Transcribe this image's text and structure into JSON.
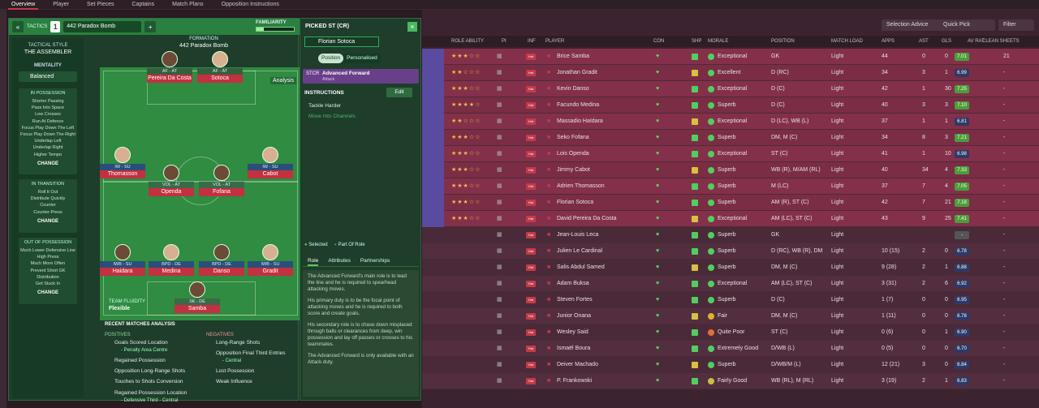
{
  "nav": {
    "tabs": [
      "Overview",
      "Player",
      "Set Pieces",
      "Captains",
      "Match Plans",
      "Opposition Instructions"
    ]
  },
  "tactics": {
    "label": "TACTICS",
    "number": "1",
    "formation_name": "442 Paradox Bomb",
    "familiarity": "FAMILIARITY",
    "tactical_style_label": "TACTICAL STYLE",
    "tactical_style": "THE ASSEMBLER",
    "mentality_label": "MENTALITY",
    "mentality": "Balanced",
    "in_possession": {
      "title": "IN POSSESSION",
      "items": [
        "Shorter Passing",
        "Pass Into Space",
        "Low Crosses",
        "Run At Defence",
        "Focus Play Down The Left",
        "Focus Play Down The Right",
        "Underlap Left",
        "Underlap Right",
        "Higher Tempo"
      ]
    },
    "in_transition": {
      "title": "IN TRANSITION",
      "items": [
        "Roll It Out",
        "Distribute Quickly",
        "Counter",
        "Counter-Press"
      ]
    },
    "out_of_possession": {
      "title": "OUT OF POSSESSION",
      "items": [
        "Much Lower Defensive Line",
        "High Press",
        "Much More Often",
        "Prevent Short GK Distribution",
        "Get Stuck In"
      ]
    },
    "change_label": "CHANGE",
    "formation_label": "FORMATION",
    "analysis": "Analysis",
    "team_fluidity_label": "TEAM FLUIDITY",
    "team_fluidity": "Flexible",
    "recent_label": "RECENT MATCHES ANALYSIS",
    "positives_label": "POSITIVES",
    "negatives_label": "NEGATIVES",
    "positives": [
      "Goals Scored Location",
      "- Penalty Area Centre",
      "Regained Possession",
      "Opposition Long-Range Shots",
      "Touches to Shots Conversion",
      "Regained Possession Location",
      "- Defensive Third - Central"
    ],
    "negatives": [
      "Long-Range Shots",
      "Opposition Final Third Entries",
      "- Central",
      "Lost Possession",
      "Weak Influence"
    ],
    "players": [
      {
        "role": "AF - AT",
        "name": "Pereira Da Costa"
      },
      {
        "role": "AF - AT",
        "name": "Sotoca"
      },
      {
        "role": "IW - SU",
        "name": "Thomasson"
      },
      {
        "role": "IW - SU",
        "name": "Cabot"
      },
      {
        "role": "VOL - AT",
        "name": "Openda"
      },
      {
        "role": "VOL - AT",
        "name": "Fofana"
      },
      {
        "role": "IWB - SU",
        "name": "Haidara"
      },
      {
        "role": "BPD - DE",
        "name": "Medina"
      },
      {
        "role": "BPD - DE",
        "name": "Danso"
      },
      {
        "role": "IWB - SU",
        "name": "Gradit"
      },
      {
        "role": "SK - DE",
        "name": "Samba"
      }
    ]
  },
  "picked": {
    "title": "PICKED ST (CR)",
    "player": "Florian Sotoca",
    "toggle": [
      "Position",
      "Personalised"
    ],
    "role_pos": "STCR",
    "role_name": "Advanced Forward",
    "role_duty": "Attack",
    "instructions_label": "INSTRUCTIONS",
    "edit": "Edit",
    "instr": [
      "Tackle Harder",
      "Move Into Channels"
    ],
    "legend_selected": "Selected",
    "legend_part": "Part Of Role",
    "tabs": [
      "Role",
      "Attributes",
      "Partnerships"
    ],
    "desc": [
      "The Advanced Forward's main role is to lead the line and he is required to spearhead attacking moves.",
      "His primary duty is to be the focal point of attacking moves and he is required to both score and create goals.",
      "His secondary role is to chase down misplaced through balls or clearances from deep, win possession and lay off passes or crosses to his teammates.",
      "The Advanced Forward is only available with an Attack duty."
    ]
  },
  "list": {
    "buttons": {
      "selection_advice": "Selection Advice",
      "quick_pick": "Quick Pick",
      "filter": "Filter"
    },
    "columns": [
      "ROLE ABILITY",
      "PI",
      "INF",
      "PLAYER",
      "CON",
      "SHP",
      "MORALE",
      "POSITION",
      "MATCH LOAD",
      "APPS",
      "AST",
      "GLS",
      "AV RAT",
      "CLEAN SHEETS"
    ],
    "rows": [
      {
        "stars": "★★★☆☆",
        "name": "Brice Samba",
        "morale": "Exceptional",
        "pos": "GK",
        "load": "Light",
        "apps": "44",
        "ast": "0",
        "gls": "0",
        "rat": "7.01",
        "cs": "21"
      },
      {
        "stars": "★★☆☆☆",
        "name": "Jonathan Gradit",
        "morale": "Excellent",
        "pos": "D (RC)",
        "load": "Light",
        "apps": "34",
        "ast": "3",
        "gls": "1",
        "rat": "6.99",
        "cs": "-"
      },
      {
        "stars": "★★★☆☆",
        "name": "Kevin Danso",
        "morale": "Exceptional",
        "pos": "D (C)",
        "load": "Light",
        "apps": "42",
        "ast": "1",
        "gls": "30",
        "rat": "7.25",
        "cs": "-"
      },
      {
        "stars": "★★★★☆",
        "name": "Facundo Medina",
        "morale": "Superb",
        "pos": "D (C)",
        "load": "Light",
        "apps": "40",
        "ast": "3",
        "gls": "3",
        "rat": "7.10",
        "cs": "-"
      },
      {
        "stars": "★★☆☆☆",
        "name": "Massadio Haïdara",
        "morale": "Exceptional",
        "pos": "D (LC), WB (L)",
        "load": "Light",
        "apps": "37",
        "ast": "1",
        "gls": "1",
        "rat": "6.81",
        "cs": "-"
      },
      {
        "stars": "★★★☆☆",
        "name": "Seko Fofana",
        "morale": "Superb",
        "pos": "DM, M (C)",
        "load": "Light",
        "apps": "34",
        "ast": "8",
        "gls": "3",
        "rat": "7.21",
        "cs": "-"
      },
      {
        "stars": "★★★☆☆",
        "name": "Lois Openda",
        "morale": "Exceptional",
        "pos": "ST (C)",
        "load": "Light",
        "apps": "41",
        "ast": "1",
        "gls": "10",
        "rat": "6.98",
        "cs": "-"
      },
      {
        "stars": "★★★☆☆",
        "name": "Jimmy Cabot",
        "morale": "Superb",
        "pos": "WB (R), M/AM (RL)",
        "load": "Light",
        "apps": "40",
        "ast": "34",
        "gls": "4",
        "rat": "7.33",
        "cs": "-"
      },
      {
        "stars": "★★★☆☆",
        "name": "Adrien Thomasson",
        "morale": "Superb",
        "pos": "M (LC)",
        "load": "Light",
        "apps": "37",
        "ast": "7",
        "gls": "4",
        "rat": "7.05",
        "cs": "-"
      },
      {
        "stars": "★★★☆☆",
        "name": "Florian Sotoca",
        "morale": "Superb",
        "pos": "AM (R), ST (C)",
        "load": "Light",
        "apps": "42",
        "ast": "7",
        "gls": "21",
        "rat": "7.18",
        "cs": "-"
      },
      {
        "stars": "★★★☆☆",
        "name": "David Pereira Da Costa",
        "morale": "Exceptional",
        "pos": "AM (LC), ST (C)",
        "load": "Light",
        "apps": "43",
        "ast": "9",
        "gls": "25",
        "rat": "7.41",
        "cs": "-"
      },
      {
        "stars": "",
        "name": "Jean-Louis Leca",
        "morale": "Superb",
        "pos": "GK",
        "load": "Light",
        "apps": "",
        "ast": "",
        "gls": "",
        "rat": "-",
        "cs": "-"
      },
      {
        "stars": "",
        "name": "Julien Le Cardinal",
        "morale": "Superb",
        "pos": "D (RC), WB (R), DM",
        "load": "Light",
        "apps": "10 (15)",
        "ast": "2",
        "gls": "0",
        "rat": "6.78",
        "cs": "-"
      },
      {
        "stars": "",
        "name": "Salis Abdul Samed",
        "morale": "Superb",
        "pos": "DM, M (C)",
        "load": "Light",
        "apps": "9 (28)",
        "ast": "2",
        "gls": "1",
        "rat": "6.88",
        "cs": "-"
      },
      {
        "stars": "",
        "name": "Adam Buksa",
        "morale": "Exceptional",
        "pos": "AM (LC), ST (C)",
        "load": "Light",
        "apps": "3 (31)",
        "ast": "2",
        "gls": "6",
        "rat": "6.92",
        "cs": "-"
      },
      {
        "stars": "",
        "name": "Steven Fortes",
        "morale": "Superb",
        "pos": "D (C)",
        "load": "Light",
        "apps": "1 (7)",
        "ast": "0",
        "gls": "0",
        "rat": "6.95",
        "cs": "-"
      },
      {
        "stars": "",
        "name": "Junior Onana",
        "morale": "Fair",
        "pos": "DM, M (C)",
        "load": "Light",
        "apps": "1 (11)",
        "ast": "0",
        "gls": "0",
        "rat": "6.78",
        "cs": "-"
      },
      {
        "stars": "",
        "name": "Wesley Said",
        "morale": "Quite Poor",
        "pos": "ST (C)",
        "load": "Light",
        "apps": "0 (6)",
        "ast": "0",
        "gls": "1",
        "rat": "6.90",
        "cs": "-"
      },
      {
        "stars": "",
        "name": "Ismaël Boura",
        "morale": "Extremely Good",
        "pos": "D/WB (L)",
        "load": "Light",
        "apps": "0 (5)",
        "ast": "0",
        "gls": "0",
        "rat": "6.70",
        "cs": "-"
      },
      {
        "stars": "",
        "name": "Deiver Machado",
        "morale": "Superb",
        "pos": "D/WB/M (L)",
        "load": "Light",
        "apps": "12 (21)",
        "ast": "3",
        "gls": "0",
        "rat": "6.84",
        "cs": "-"
      },
      {
        "stars": "",
        "name": "P. Frankowski",
        "morale": "Fairly Good",
        "pos": "WB (RL), M (RL)",
        "load": "Light",
        "apps": "3 (19)",
        "ast": "2",
        "gls": "1",
        "rat": "6.83",
        "cs": "-"
      }
    ]
  },
  "colors": {
    "pitch": "#2f8c40",
    "accent_red": "#c33a4a",
    "role_purple": "#6a3f8a",
    "heart": "#5ddc6a"
  }
}
